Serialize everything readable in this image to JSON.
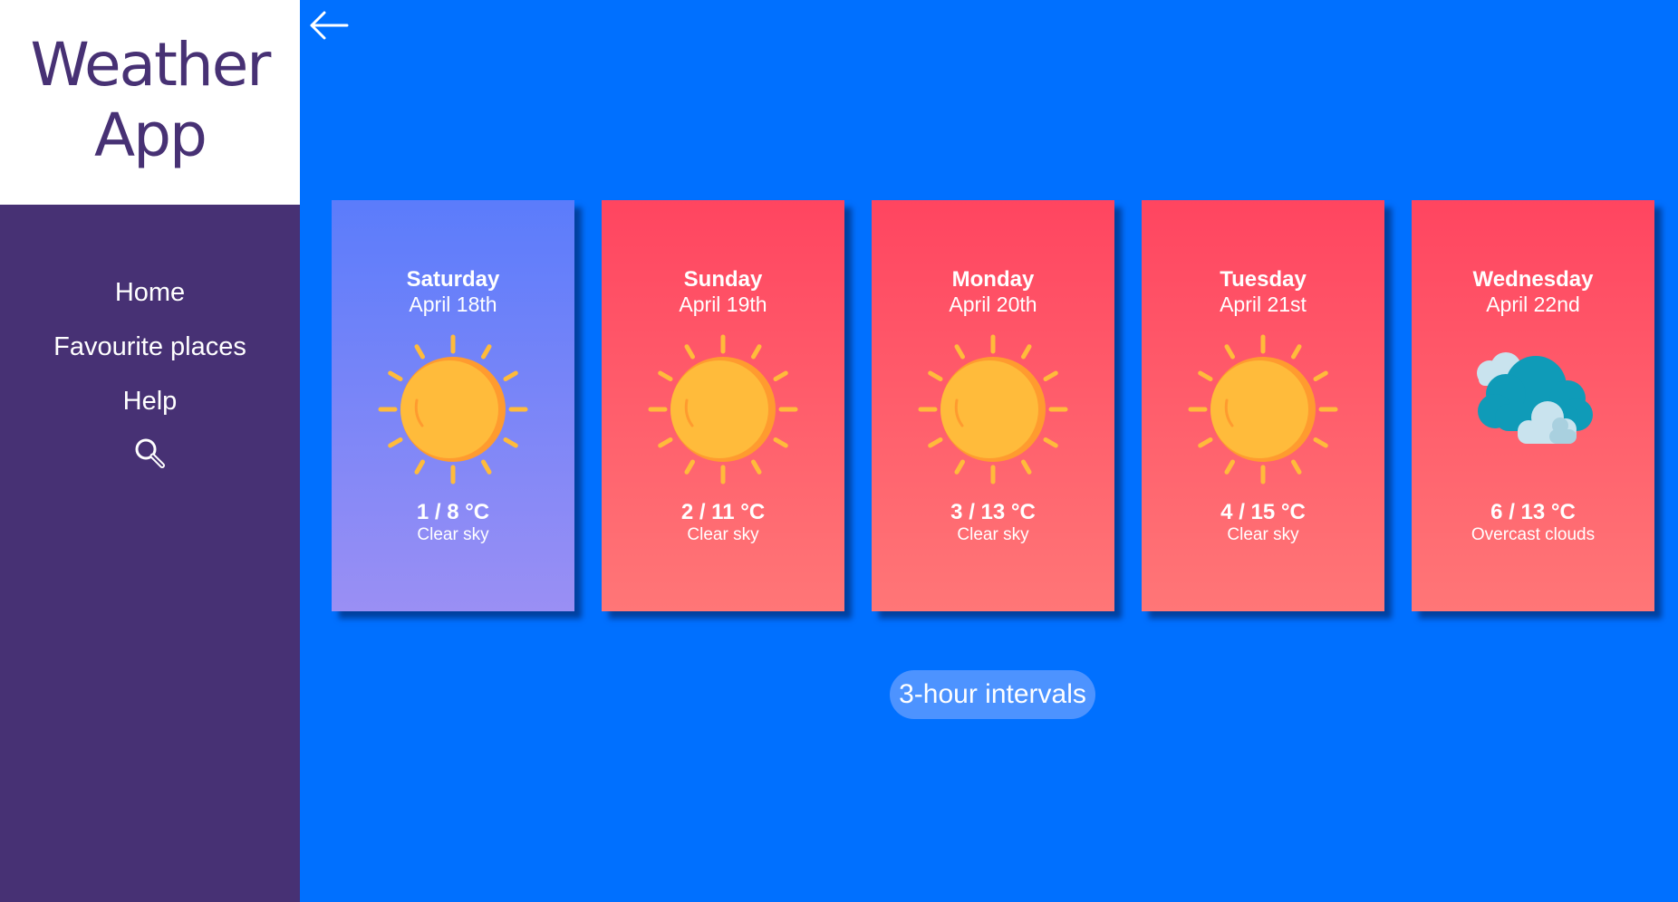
{
  "sidebar": {
    "logo": {
      "line1": "Weather",
      "line2": "App"
    },
    "nav": [
      {
        "label": "Home"
      },
      {
        "label": "Favourite places"
      },
      {
        "label": "Help"
      }
    ],
    "search_icon": "magnifier-icon"
  },
  "header": {
    "back_icon": "arrow-left-icon"
  },
  "forecast": [
    {
      "day": "Saturday",
      "date": "April 18th",
      "temp": "1 / 8 °C",
      "desc": "Clear sky",
      "icon": "sun-icon",
      "theme": "cool"
    },
    {
      "day": "Sunday",
      "date": "April 19th",
      "temp": "2 / 11 °C",
      "desc": "Clear sky",
      "icon": "sun-icon",
      "theme": "warm"
    },
    {
      "day": "Monday",
      "date": "April 20th",
      "temp": "3 / 13 °C",
      "desc": "Clear sky",
      "icon": "sun-icon",
      "theme": "warm"
    },
    {
      "day": "Tuesday",
      "date": "April 21st",
      "temp": "4 / 15 °C",
      "desc": "Clear sky",
      "icon": "sun-icon",
      "theme": "warm"
    },
    {
      "day": "Wednesday",
      "date": "April 22nd",
      "temp": "6 / 13 °C",
      "desc": "Overcast clouds",
      "icon": "clouds-icon",
      "theme": "warm"
    }
  ],
  "interval_button": {
    "label": "3-hour intervals"
  },
  "colors": {
    "background": "#0070ff",
    "sidebar": "#473174",
    "logo_text": "#473174",
    "card_cool_top": "#5b7cfb",
    "card_cool_bottom": "#9a8ff4",
    "card_warm_top": "#ff4560",
    "card_warm_bottom": "#ff7677",
    "interval_button": "#4d93ff",
    "sun": "#ffbb3b",
    "sun_shade": "#ff9b2f"
  }
}
